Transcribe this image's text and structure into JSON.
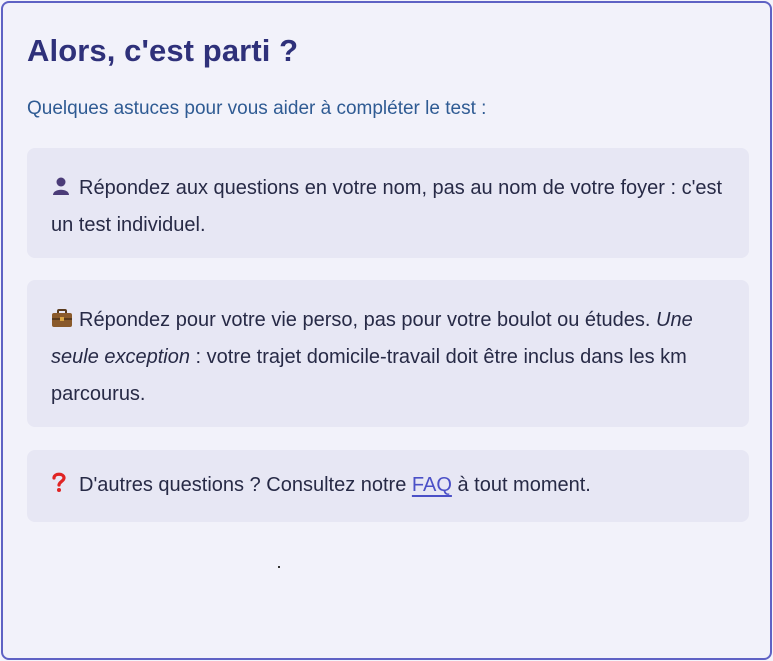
{
  "title": "Alors, c'est parti ?",
  "subtitle": "Quelques astuces pour vous aider à compléter le test :",
  "tips": [
    {
      "icon": "person-icon",
      "text": "Répondez aux questions en votre nom, pas au nom de votre foyer : c'est un test individuel."
    },
    {
      "icon": "briefcase-icon",
      "text_before": "Répondez pour votre vie perso, pas pour votre boulot ou études. ",
      "emphasis": "Une seule exception",
      "text_after": " : votre trajet domicile-travail doit être inclus dans les km parcourus."
    },
    {
      "icon": "question-mark-icon",
      "text_before": "D'autres questions ? Consultez notre ",
      "link": "FAQ",
      "text_after": " à tout moment."
    }
  ],
  "colors": {
    "border": "#5f62c4",
    "title": "#2f317a",
    "subtitle": "#2f5b93",
    "tip_background": "#e7e7f4",
    "link": "#4b50c7"
  }
}
